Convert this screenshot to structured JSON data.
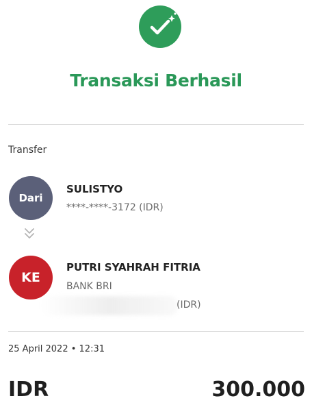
{
  "status": {
    "title": "Transaksi Berhasil",
    "icon": "check-icon",
    "color": "#2e9d5a"
  },
  "section_label": "Transfer",
  "from": {
    "avatar_label": "Dari",
    "name": "SULISTYO",
    "account": "****-****-3172 (IDR)",
    "avatar_color": "#5b6079"
  },
  "to": {
    "avatar_label": "KE",
    "name": "PUTRI SYAHRAH FITRIA",
    "bank": "BANK BRI",
    "currency_suffix": "(IDR)",
    "avatar_color": "#c8222a"
  },
  "datetime": "25 April 2022 • 12:31",
  "amount": {
    "currency": "IDR",
    "value": "300.000"
  }
}
